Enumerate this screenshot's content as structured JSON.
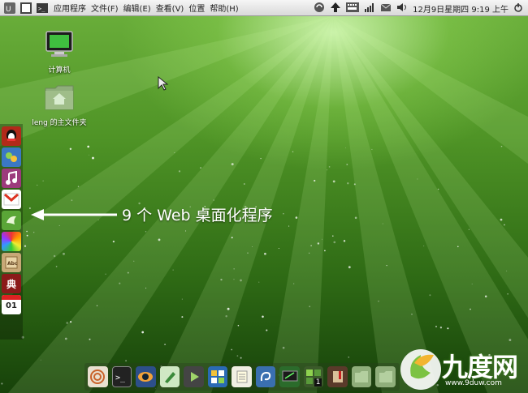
{
  "top_panel": {
    "menus": [
      "应用程序",
      "文件(F)",
      "编辑(E)",
      "查看(V)",
      "位置",
      "帮助(H)"
    ],
    "clock": "12月9日星期四 9:19 上午"
  },
  "desktop": {
    "icons": [
      {
        "label": "计算机"
      },
      {
        "label": "leng 的主文件夹"
      }
    ],
    "annotation": "9 个 Web 桌面化程序"
  },
  "left_dock": {
    "items": [
      "qq-icon",
      "chat-icon",
      "music-icon",
      "gmail-icon",
      "bird-icon",
      "photo-icon",
      "dictionary-icon",
      "dian-icon",
      "calendar-icon"
    ],
    "dian_label": "典",
    "calendar_day": "01"
  },
  "bottom_dock": {
    "badge": "1"
  },
  "watermark": {
    "text": "九度网",
    "url": "www.9duw.com"
  },
  "colors": {
    "accent": "#4f9426",
    "panel": "#e4e4e4"
  }
}
